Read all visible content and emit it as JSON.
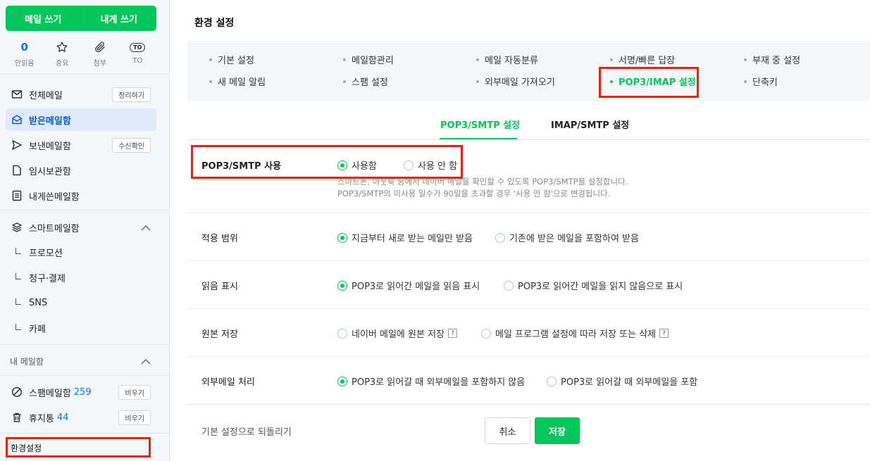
{
  "sidebar": {
    "write_mail": "메일 쓰기",
    "write_to_me": "내게 쓰기",
    "quick": [
      {
        "value": "0",
        "label": "안읽음"
      },
      {
        "icon": "star-icon",
        "label": "중요"
      },
      {
        "icon": "paperclip-icon",
        "label": "첨부"
      },
      {
        "icon": "to-icon",
        "icon_text": "TO",
        "label": "TO"
      }
    ],
    "items": [
      {
        "label": "전체메일",
        "button": "정리하기",
        "icon": "mail-icon"
      },
      {
        "label": "받은메일함",
        "icon": "inbox-icon",
        "active": true
      },
      {
        "label": "보낸메일함",
        "button": "수신확인",
        "icon": "send-icon"
      },
      {
        "label": "임시보관함",
        "icon": "draft-icon"
      },
      {
        "label": "내게쓴메일함",
        "icon": "note-icon"
      }
    ],
    "smart": {
      "label": "스마트메일함",
      "subs": [
        "프로모션",
        "청구·결제",
        "SNS",
        "카페"
      ]
    },
    "my_mailbox_label": "내 메일함",
    "spam": {
      "label": "스팸메일함",
      "count": "259",
      "button": "비우기"
    },
    "trash": {
      "label": "휴지통",
      "count": "44",
      "button": "비우기"
    },
    "settings": "환경설정"
  },
  "main": {
    "title": "환경 설정",
    "menu": [
      "기본 설정",
      "메일함관리",
      "메일 자동분류",
      "서명/빠른 답장",
      "부재 중 설정",
      "새 메일 알림",
      "스팸 설정",
      "외부메일 가져오기",
      "POP3/IMAP 설정",
      "단축키"
    ],
    "active_menu": "POP3/IMAP 설정",
    "tabs": [
      "POP3/SMTP 설정",
      "IMAP/SMTP 설정"
    ],
    "active_tab": "POP3/SMTP 설정",
    "rows": {
      "use": {
        "label": "POP3/SMTP 사용",
        "opt1": "사용함",
        "opt2": "사용 안 함",
        "selected": "사용함",
        "desc1": "스마트폰, 아웃룩 등에서 네이버 메일을 확인할 수 있도록 POP3/SMTP를 설정합니다.",
        "desc2": "POP3/SMTP의 미사용 일수가 90일을 초과할 경우 '사용 안 함'으로 변경됩니다."
      },
      "scope": {
        "label": "적용 범위",
        "opt1": "지금부터 새로 받는 메일만 받음",
        "opt2": "기존에 받은 메일을 포함하여 받음",
        "selected": "지금부터 새로 받는 메일만 받음"
      },
      "read": {
        "label": "읽음 표시",
        "opt1": "POP3로 읽어간 메일을 읽음 표시",
        "opt2": "POP3로 읽어간 메일을 읽지 않음으로 표시",
        "selected": "POP3로 읽어간 메일을 읽음 표시"
      },
      "original": {
        "label": "원본 저장",
        "opt1": "네이버 메일에 원본 저장",
        "opt2": "메일 프로그램 설정에 따라 저장 또는 삭제",
        "help": "?",
        "selected": ""
      },
      "external": {
        "label": "외부메일 처리",
        "opt1": "POP3로 읽어갈 때 외부메일을 포함하지 않음",
        "opt2": "POP3로 읽어갈 때 외부메일을 포함",
        "selected": "POP3로 읽어갈 때 외부메일을 포함하지 않음"
      }
    },
    "reset": "기본 설정으로 되돌리기",
    "cancel": "취소",
    "save": "저장"
  },
  "colors": {
    "accent": "#03c75a",
    "highlight": "#e8230f",
    "link_blue": "#0c77e0"
  }
}
